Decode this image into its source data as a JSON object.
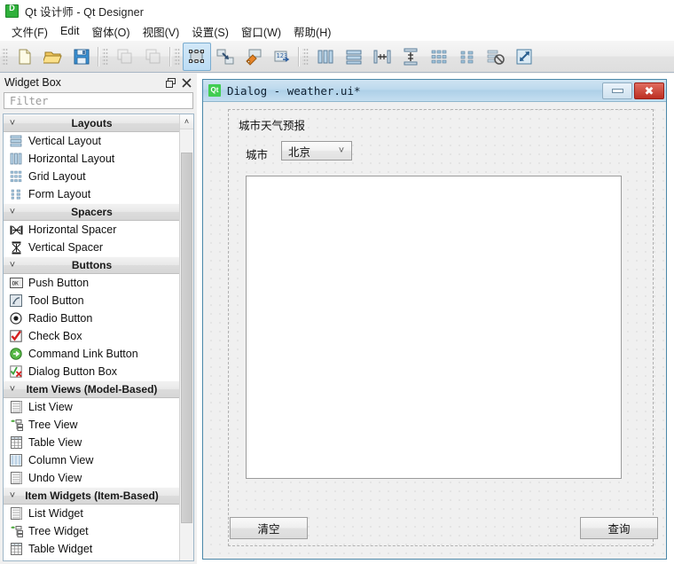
{
  "window": {
    "title": "Qt 设计师 - Qt Designer",
    "app_icon": "designer-icon"
  },
  "menubar": {
    "items": [
      {
        "label": "文件(F)",
        "name": "menu-file"
      },
      {
        "label": "Edit",
        "name": "menu-edit"
      },
      {
        "label": "窗体(O)",
        "name": "menu-form"
      },
      {
        "label": "视图(V)",
        "name": "menu-view"
      },
      {
        "label": "设置(S)",
        "name": "menu-settings"
      },
      {
        "label": "窗口(W)",
        "name": "menu-window"
      },
      {
        "label": "帮助(H)",
        "name": "menu-help"
      }
    ]
  },
  "toolbar": {
    "groups": [
      {
        "buttons": [
          {
            "icon": "new-file-icon",
            "enabled": true,
            "active": false
          },
          {
            "icon": "open-folder-icon",
            "enabled": true,
            "active": false
          },
          {
            "icon": "save-floppy-icon",
            "enabled": true,
            "active": false
          }
        ]
      },
      {
        "buttons": [
          {
            "icon": "copy-icon",
            "enabled": false,
            "active": false
          },
          {
            "icon": "paste-icon",
            "enabled": false,
            "active": false
          }
        ]
      },
      {
        "buttons": [
          {
            "icon": "edit-widgets-icon",
            "enabled": true,
            "active": true
          },
          {
            "icon": "edit-signals-slots-icon",
            "enabled": true,
            "active": false
          },
          {
            "icon": "edit-buddies-icon",
            "enabled": true,
            "active": false
          },
          {
            "icon": "edit-tab-order-icon",
            "enabled": true,
            "active": false
          }
        ]
      },
      {
        "buttons": [
          {
            "icon": "layout-horizontal-icon",
            "enabled": true,
            "active": false
          },
          {
            "icon": "layout-vertical-icon",
            "enabled": true,
            "active": false
          },
          {
            "icon": "layout-splitter-horizontal-icon",
            "enabled": true,
            "active": false
          },
          {
            "icon": "layout-splitter-vertical-icon",
            "enabled": true,
            "active": false
          },
          {
            "icon": "layout-grid-icon",
            "enabled": true,
            "active": false
          },
          {
            "icon": "layout-form-icon",
            "enabled": true,
            "active": false
          },
          {
            "icon": "break-layout-icon",
            "enabled": true,
            "active": false
          },
          {
            "icon": "adjust-size-icon",
            "enabled": true,
            "active": false
          }
        ]
      }
    ]
  },
  "widget_box": {
    "title": "Widget Box",
    "float_button": "float-icon",
    "close_button": "close-icon",
    "filter_placeholder": "Filter",
    "filter_value": "",
    "categories": [
      {
        "name": "Layouts",
        "expanded": true,
        "items": [
          {
            "label": "Vertical Layout",
            "icon": "vertical-layout-icon"
          },
          {
            "label": "Horizontal Layout",
            "icon": "horizontal-layout-icon"
          },
          {
            "label": "Grid Layout",
            "icon": "grid-layout-icon"
          },
          {
            "label": "Form Layout",
            "icon": "form-layout-icon"
          }
        ]
      },
      {
        "name": "Spacers",
        "expanded": true,
        "items": [
          {
            "label": "Horizontal Spacer",
            "icon": "horizontal-spacer-icon"
          },
          {
            "label": "Vertical Spacer",
            "icon": "vertical-spacer-icon"
          }
        ]
      },
      {
        "name": "Buttons",
        "expanded": true,
        "items": [
          {
            "label": "Push Button",
            "icon": "push-button-icon"
          },
          {
            "label": "Tool Button",
            "icon": "tool-button-icon"
          },
          {
            "label": "Radio Button",
            "icon": "radio-button-icon"
          },
          {
            "label": "Check Box",
            "icon": "check-box-icon"
          },
          {
            "label": "Command Link Button",
            "icon": "command-link-button-icon"
          },
          {
            "label": "Dialog Button Box",
            "icon": "dialog-button-box-icon"
          }
        ]
      },
      {
        "name": "Item Views (Model-Based)",
        "expanded": true,
        "items": [
          {
            "label": "List View",
            "icon": "list-view-icon"
          },
          {
            "label": "Tree View",
            "icon": "tree-view-icon"
          },
          {
            "label": "Table View",
            "icon": "table-view-icon"
          },
          {
            "label": "Column View",
            "icon": "column-view-icon"
          },
          {
            "label": "Undo View",
            "icon": "undo-view-icon"
          }
        ]
      },
      {
        "name": "Item Widgets (Item-Based)",
        "expanded": true,
        "items": [
          {
            "label": "List Widget",
            "icon": "list-widget-icon"
          },
          {
            "label": "Tree Widget",
            "icon": "tree-widget-icon"
          },
          {
            "label": "Table Widget",
            "icon": "table-widget-icon"
          }
        ]
      }
    ]
  },
  "form": {
    "titlebar": {
      "icon": "qt-icon",
      "title": "Dialog - weather.ui*",
      "minimize_label": "minimize-icon",
      "close_label": "close-icon"
    },
    "heading_label": "城市天气预报",
    "city_label": "城市",
    "city_combo": {
      "value": "北京",
      "arrow": "chevron-down-icon"
    },
    "result_textedit": "",
    "clear_button": "清空",
    "query_button": "查询"
  },
  "colors": {
    "accent": "#4a87a8",
    "titlebar_gradient_top": "#cfe4f2",
    "close_button": "#bd2f23",
    "selected_tool": "#bcdcf4",
    "qt_green": "#41cd52"
  }
}
